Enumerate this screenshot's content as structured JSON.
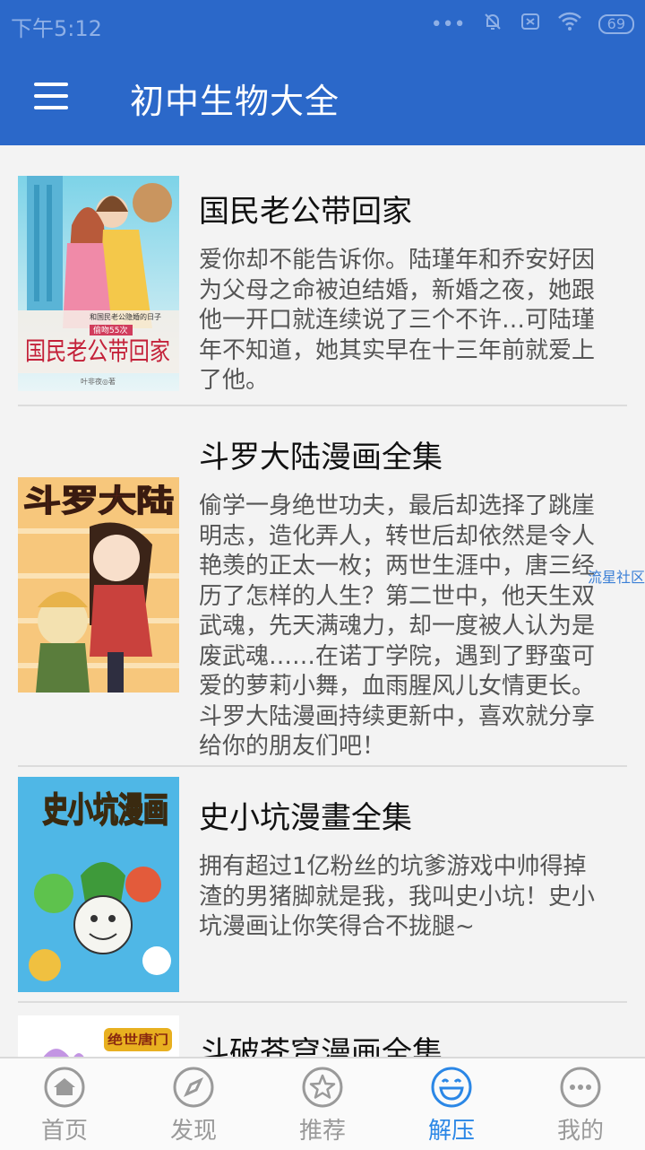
{
  "status_bar": {
    "time": "下午5:12",
    "battery": "69",
    "icons": [
      "signal-dots-icon",
      "mute-bell-icon",
      "sim-icon",
      "wifi-icon",
      "battery-icon"
    ]
  },
  "app_bar": {
    "title": "初中生物大全",
    "menu_icon": "hamburger-menu-icon"
  },
  "colors": {
    "primary": "#2b68c9",
    "active_tab": "#2b87e6",
    "inactive_tab": "#9a9a9a"
  },
  "items": [
    {
      "title": "国民老公带回家",
      "cover_text": "国民老公带回家",
      "cover_subtext": "和国民老公隐婚的日子",
      "cover_badge": "偷吻55次",
      "cover_author": "叶非夜◎著",
      "description": "爱你却不能告诉你。陆瑾年和乔安好因为父母之命被迫结婚，新婚之夜，她跟他一开口就连续说了三个不许…可陆瑾年不知道，她其实早在十三年前就爱上了他。"
    },
    {
      "title": "斗罗大陆漫画全集",
      "cover_text": "斗罗大陆",
      "description": "偷学一身绝世功夫，最后却选择了跳崖明志，造化弄人，转世后却依然是令人艳羡的正太一枚；两世生涯中，唐三经历了怎样的人生？第二世中，他天生双武魂，先天满魂力，却一度被人认为是废武魂……在诺丁学院，遇到了野蛮可爱的萝莉小舞，血雨腥风儿女情更长。斗罗大陆漫画持续更新中，喜欢就分享给你的朋友们吧！"
    },
    {
      "title": "史小坑漫畫全集",
      "cover_text": "史小坑漫画",
      "description": "拥有超过1亿粉丝的坑爹游戏中帅得掉渣的男猪脚就是我，我叫史小坑！史小坑漫画让你笑得合不拢腿~"
    },
    {
      "title": "斗破苍穹漫画全集",
      "cover_text": "绝世唐门"
    }
  ],
  "watermark": "流星社区",
  "bottom_nav": [
    {
      "label": "首页",
      "icon": "home-icon",
      "active": false
    },
    {
      "label": "发现",
      "icon": "compass-icon",
      "active": false
    },
    {
      "label": "推荐",
      "icon": "star-icon",
      "active": false
    },
    {
      "label": "解压",
      "icon": "smile-icon",
      "active": true
    },
    {
      "label": "我的",
      "icon": "more-dots-icon",
      "active": false
    }
  ]
}
